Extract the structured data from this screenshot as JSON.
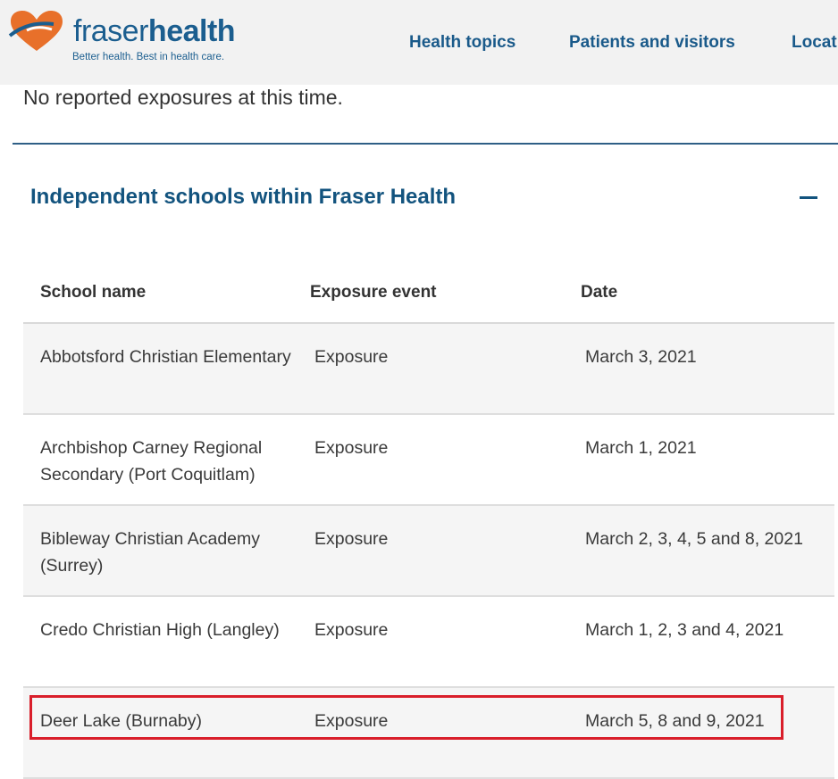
{
  "header": {
    "logo": {
      "light": "fraser",
      "bold": "health",
      "tagline": "Better health. Best in health care."
    },
    "nav": [
      "Health topics",
      "Patients and visitors",
      "Locat"
    ]
  },
  "notice": "No reported exposures at this time.",
  "section": {
    "title": "Independent schools within Fraser Health"
  },
  "table": {
    "headers": [
      "School name",
      "Exposure event",
      "Date"
    ],
    "rows": [
      {
        "school": "Abbotsford Christian Elementary",
        "event": "Exposure",
        "date": "March 3, 2021"
      },
      {
        "school": "Archbishop Carney Regional Secondary (Port Coquitlam)",
        "event": "Exposure",
        "date": "March 1, 2021"
      },
      {
        "school": "Bibleway Christian Academy (Surrey)",
        "event": "Exposure",
        "date": "March 2, 3, 4, 5 and 8, 2021"
      },
      {
        "school": "Credo Christian High (Langley)",
        "event": "Exposure",
        "date": "March 1, 2, 3 and 4, 2021"
      },
      {
        "school": "Deer Lake (Burnaby)",
        "event": "Exposure",
        "date": "March 5, 8 and 9, 2021"
      }
    ]
  },
  "colors": {
    "brand_blue": "#1b5e8f",
    "logo_orange": "#e8702a",
    "highlight_red": "#d91e2a"
  }
}
